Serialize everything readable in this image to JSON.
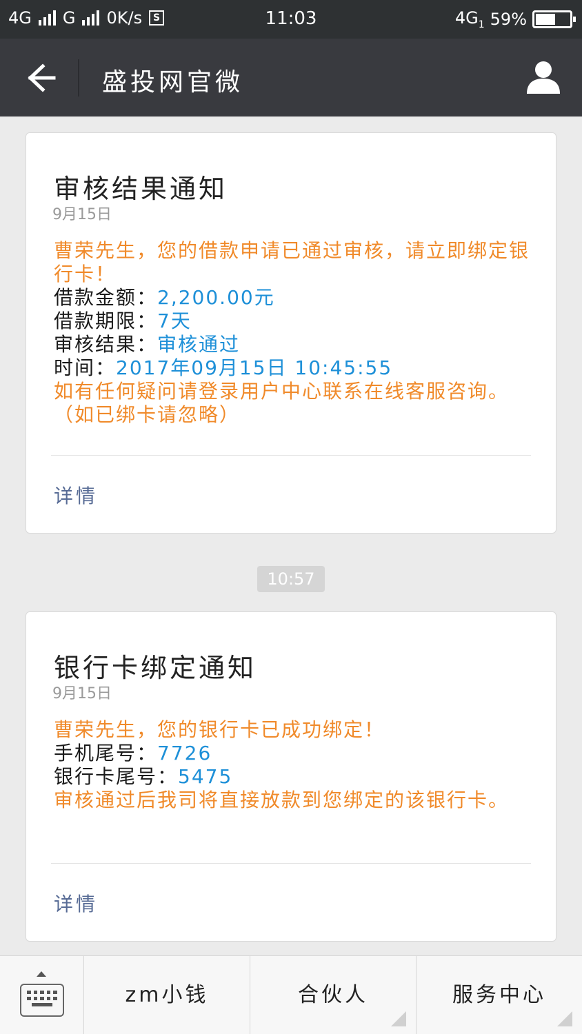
{
  "status_bar": {
    "net1": "4G",
    "net2": "G",
    "speed": "0K/s",
    "sbox": "S",
    "time": "11:03",
    "net3": "4G",
    "net3_sub": "1",
    "battery_percent": "59%",
    "battery_level": 59
  },
  "header": {
    "title": "盛投网官微",
    "back_icon": "arrow-left-icon",
    "user_icon": "person-icon"
  },
  "messages": [
    {
      "title": "审核结果通知",
      "date": "9月15日",
      "intro": "曹荣先生，您的借款申请已通过审核，请立即绑定银行卡！",
      "fields": [
        {
          "label": "借款金额：",
          "value": "2,200.00元"
        },
        {
          "label": "借款期限：",
          "value": "7天"
        },
        {
          "label": "审核结果：",
          "value": "审核通过"
        },
        {
          "label": "时间：",
          "value": "2017年09月15日 10:45:55"
        }
      ],
      "remark": "如有任何疑问请登录用户中心联系在线客服咨询。（如已绑卡请忽略）",
      "detail": "详情"
    },
    {
      "title": "银行卡绑定通知",
      "date": "9月15日",
      "intro": "曹荣先生，您的银行卡已成功绑定！",
      "fields": [
        {
          "label": "手机尾号：",
          "value": "7726"
        },
        {
          "label": "银行卡尾号：",
          "value": "5475"
        }
      ],
      "remark": "审核通过后我司将直接放款到您绑定的该银行卡。",
      "detail": "详情"
    }
  ],
  "time_divider": "10:57",
  "bottom_menu": {
    "keyboard_icon": "keyboard-icon",
    "items": [
      {
        "label": "zm小钱"
      },
      {
        "label": "合伙人"
      },
      {
        "label": "服务中心"
      }
    ]
  },
  "colors": {
    "status_bar_bg": "#2e3133",
    "header_bg": "#393a3f",
    "orange_text": "#f08a2a",
    "blue_value": "#1e90d8",
    "link": "#576b95"
  }
}
